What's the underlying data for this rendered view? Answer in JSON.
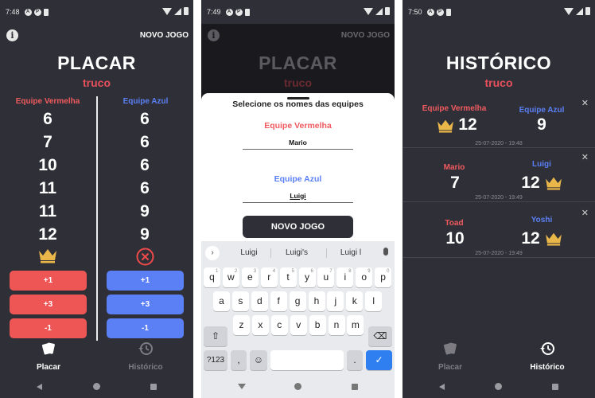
{
  "status": {
    "p1_time": "7:48",
    "p2_time": "7:49",
    "p3_time": "7:50"
  },
  "header": {
    "info_label": "i",
    "new_game": "NOVO JOGO"
  },
  "scoreboard": {
    "title": "PLACAR",
    "game": "truco",
    "red_team": "Equipe Vermelha",
    "blue_team": "Equipe Azul",
    "red_scores": [
      "6",
      "7",
      "10",
      "11",
      "11",
      "12"
    ],
    "blue_scores": [
      "6",
      "6",
      "6",
      "6",
      "9",
      "9"
    ],
    "buttons": [
      "+1",
      "+3",
      "-1"
    ]
  },
  "tabs": {
    "scoreboard": "Placar",
    "history": "Histórico"
  },
  "dialog": {
    "title": "Selecione os nomes das equipes",
    "red_team": "Equipe Vermelha",
    "red_value": "Mario",
    "blue_team": "Equipe Azul",
    "blue_value": "Luigi",
    "button": "NOVO JOGO"
  },
  "keyboard": {
    "suggestions": [
      "Luigi",
      "Luigi's",
      "Luigi l"
    ],
    "row1": [
      "q",
      "w",
      "e",
      "r",
      "t",
      "y",
      "u",
      "i",
      "o",
      "p"
    ],
    "row1_hints": [
      "1",
      "2",
      "3",
      "4",
      "5",
      "6",
      "7",
      "8",
      "9",
      "0"
    ],
    "row2": [
      "a",
      "s",
      "d",
      "f",
      "g",
      "h",
      "j",
      "k",
      "l"
    ],
    "row3": [
      "z",
      "x",
      "c",
      "v",
      "b",
      "n",
      "m"
    ],
    "symbols": "?123",
    "comma": ",",
    "period": ".",
    "emoji": "☺"
  },
  "history": {
    "title": "HISTÓRICO",
    "game": "truco",
    "games": [
      {
        "left_name": "Equipe Vermelha",
        "left_score": "12",
        "right_name": "Equipe Azul",
        "right_score": "9",
        "date": "25-07-2020 - 19:48",
        "winner": "left"
      },
      {
        "left_name": "Mario",
        "left_score": "7",
        "right_name": "Luigi",
        "right_score": "12",
        "date": "25-07-2020 - 19:49",
        "winner": "right"
      },
      {
        "left_name": "Toad",
        "left_score": "10",
        "right_name": "Yoshi",
        "right_score": "12",
        "date": "25-07-2020 - 19:49",
        "winner": "right"
      }
    ]
  },
  "colors": {
    "background": "#2f3037",
    "red": "#f05a5f",
    "blue": "#5b7ff5",
    "crown": "#e9b64a"
  }
}
